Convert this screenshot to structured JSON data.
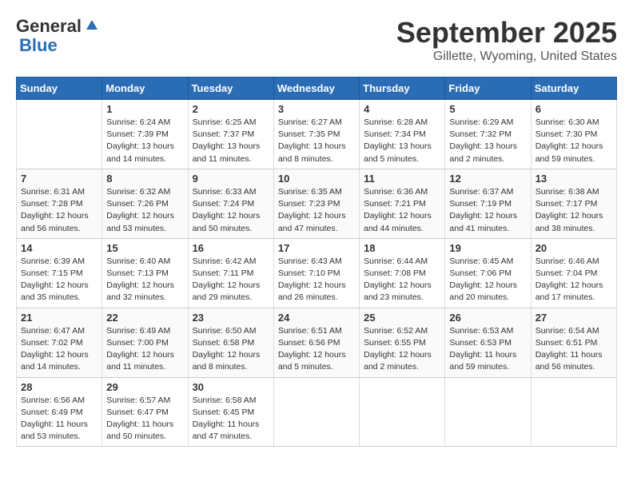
{
  "header": {
    "logo_general": "General",
    "logo_blue": "Blue",
    "month_title": "September 2025",
    "location": "Gillette, Wyoming, United States"
  },
  "days_of_week": [
    "Sunday",
    "Monday",
    "Tuesday",
    "Wednesday",
    "Thursday",
    "Friday",
    "Saturday"
  ],
  "weeks": [
    [
      {
        "date": "",
        "info": ""
      },
      {
        "date": "1",
        "info": "Sunrise: 6:24 AM\nSunset: 7:39 PM\nDaylight: 13 hours\nand 14 minutes."
      },
      {
        "date": "2",
        "info": "Sunrise: 6:25 AM\nSunset: 7:37 PM\nDaylight: 13 hours\nand 11 minutes."
      },
      {
        "date": "3",
        "info": "Sunrise: 6:27 AM\nSunset: 7:35 PM\nDaylight: 13 hours\nand 8 minutes."
      },
      {
        "date": "4",
        "info": "Sunrise: 6:28 AM\nSunset: 7:34 PM\nDaylight: 13 hours\nand 5 minutes."
      },
      {
        "date": "5",
        "info": "Sunrise: 6:29 AM\nSunset: 7:32 PM\nDaylight: 13 hours\nand 2 minutes."
      },
      {
        "date": "6",
        "info": "Sunrise: 6:30 AM\nSunset: 7:30 PM\nDaylight: 12 hours\nand 59 minutes."
      }
    ],
    [
      {
        "date": "7",
        "info": "Sunrise: 6:31 AM\nSunset: 7:28 PM\nDaylight: 12 hours\nand 56 minutes."
      },
      {
        "date": "8",
        "info": "Sunrise: 6:32 AM\nSunset: 7:26 PM\nDaylight: 12 hours\nand 53 minutes."
      },
      {
        "date": "9",
        "info": "Sunrise: 6:33 AM\nSunset: 7:24 PM\nDaylight: 12 hours\nand 50 minutes."
      },
      {
        "date": "10",
        "info": "Sunrise: 6:35 AM\nSunset: 7:23 PM\nDaylight: 12 hours\nand 47 minutes."
      },
      {
        "date": "11",
        "info": "Sunrise: 6:36 AM\nSunset: 7:21 PM\nDaylight: 12 hours\nand 44 minutes."
      },
      {
        "date": "12",
        "info": "Sunrise: 6:37 AM\nSunset: 7:19 PM\nDaylight: 12 hours\nand 41 minutes."
      },
      {
        "date": "13",
        "info": "Sunrise: 6:38 AM\nSunset: 7:17 PM\nDaylight: 12 hours\nand 38 minutes."
      }
    ],
    [
      {
        "date": "14",
        "info": "Sunrise: 6:39 AM\nSunset: 7:15 PM\nDaylight: 12 hours\nand 35 minutes."
      },
      {
        "date": "15",
        "info": "Sunrise: 6:40 AM\nSunset: 7:13 PM\nDaylight: 12 hours\nand 32 minutes."
      },
      {
        "date": "16",
        "info": "Sunrise: 6:42 AM\nSunset: 7:11 PM\nDaylight: 12 hours\nand 29 minutes."
      },
      {
        "date": "17",
        "info": "Sunrise: 6:43 AM\nSunset: 7:10 PM\nDaylight: 12 hours\nand 26 minutes."
      },
      {
        "date": "18",
        "info": "Sunrise: 6:44 AM\nSunset: 7:08 PM\nDaylight: 12 hours\nand 23 minutes."
      },
      {
        "date": "19",
        "info": "Sunrise: 6:45 AM\nSunset: 7:06 PM\nDaylight: 12 hours\nand 20 minutes."
      },
      {
        "date": "20",
        "info": "Sunrise: 6:46 AM\nSunset: 7:04 PM\nDaylight: 12 hours\nand 17 minutes."
      }
    ],
    [
      {
        "date": "21",
        "info": "Sunrise: 6:47 AM\nSunset: 7:02 PM\nDaylight: 12 hours\nand 14 minutes."
      },
      {
        "date": "22",
        "info": "Sunrise: 6:49 AM\nSunset: 7:00 PM\nDaylight: 12 hours\nand 11 minutes."
      },
      {
        "date": "23",
        "info": "Sunrise: 6:50 AM\nSunset: 6:58 PM\nDaylight: 12 hours\nand 8 minutes."
      },
      {
        "date": "24",
        "info": "Sunrise: 6:51 AM\nSunset: 6:56 PM\nDaylight: 12 hours\nand 5 minutes."
      },
      {
        "date": "25",
        "info": "Sunrise: 6:52 AM\nSunset: 6:55 PM\nDaylight: 12 hours\nand 2 minutes."
      },
      {
        "date": "26",
        "info": "Sunrise: 6:53 AM\nSunset: 6:53 PM\nDaylight: 11 hours\nand 59 minutes."
      },
      {
        "date": "27",
        "info": "Sunrise: 6:54 AM\nSunset: 6:51 PM\nDaylight: 11 hours\nand 56 minutes."
      }
    ],
    [
      {
        "date": "28",
        "info": "Sunrise: 6:56 AM\nSunset: 6:49 PM\nDaylight: 11 hours\nand 53 minutes."
      },
      {
        "date": "29",
        "info": "Sunrise: 6:57 AM\nSunset: 6:47 PM\nDaylight: 11 hours\nand 50 minutes."
      },
      {
        "date": "30",
        "info": "Sunrise: 6:58 AM\nSunset: 6:45 PM\nDaylight: 11 hours\nand 47 minutes."
      },
      {
        "date": "",
        "info": ""
      },
      {
        "date": "",
        "info": ""
      },
      {
        "date": "",
        "info": ""
      },
      {
        "date": "",
        "info": ""
      }
    ]
  ]
}
